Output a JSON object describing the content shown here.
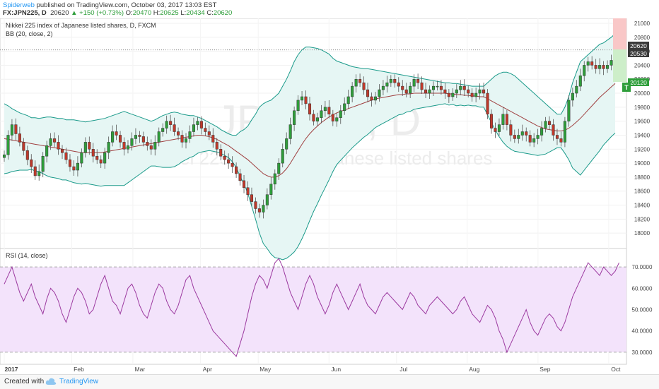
{
  "header": {
    "author": "Spiderweb",
    "published": " published on TradingView.com, October 03, 2017 13:03 EST",
    "symbol": "FX:JPN225, D",
    "last": "20620",
    "change": "▲ +150 (+0.73%)",
    "o_label": "O:",
    "o_val": "20470",
    "h_label": "H:",
    "h_val": "20625",
    "l_label": "L:",
    "l_val": "20434",
    "c_label": "C:",
    "c_val": "20620"
  },
  "legend": {
    "main_title": "Nikkei 225 index of Japanese listed shares, D, FXCM",
    "bb": "BB (20, close, 2)",
    "rsi": "RSI (14, close)"
  },
  "watermark": {
    "symbol": "JPN225, D",
    "desc": "Nikkei 225 index of Japanese listed shares"
  },
  "price_labels": {
    "last": "20620",
    "upper_marker": "20530",
    "lower_marker": "20120",
    "flag": "T"
  },
  "footer": {
    "created": "Created with",
    "brand": "TradingView"
  },
  "colors": {
    "up": "#2e9e3a",
    "down": "#c0392b",
    "bb_band": "#1a9a8a",
    "bb_mid": "#a04040",
    "bb_fill": "#e6f6f4",
    "rsi_line": "#9c3aa0",
    "rsi_fill": "#f3e3fb"
  },
  "chart_data": [
    {
      "type": "candlestick",
      "title": "Nikkei 225 index of Japanese listed shares, D, FXCM",
      "ylim": [
        17800,
        21050
      ],
      "y_ticks": [
        "21000",
        "20800",
        "20600",
        "20400",
        "20200",
        "20000",
        "19800",
        "19600",
        "19400",
        "19200",
        "19000",
        "18800",
        "18600",
        "18400",
        "18200",
        "18000"
      ],
      "x_ticks": [
        "2017",
        "Feb",
        "Mar",
        "Apr",
        "May",
        "Jun",
        "Jul",
        "Aug",
        "Sep",
        "Oct"
      ],
      "close": [
        19120,
        19400,
        19550,
        19420,
        19300,
        19180,
        19050,
        18950,
        18820,
        18880,
        19100,
        19250,
        19350,
        19300,
        19200,
        19150,
        19050,
        18950,
        18900,
        19000,
        19150,
        19300,
        19200,
        19100,
        19050,
        19000,
        19150,
        19300,
        19450,
        19400,
        19300,
        19200,
        19250,
        19350,
        19400,
        19380,
        19300,
        19250,
        19200,
        19300,
        19450,
        19500,
        19600,
        19550,
        19450,
        19400,
        19300,
        19350,
        19450,
        19550,
        19600,
        19500,
        19450,
        19400,
        19300,
        19200,
        19100,
        19050,
        19000,
        18950,
        18850,
        18750,
        18650,
        18550,
        18450,
        18350,
        18300,
        18400,
        18550,
        18700,
        18850,
        19000,
        19200,
        19350,
        19550,
        19750,
        19900,
        19950,
        19850,
        19700,
        19600,
        19650,
        19750,
        19800,
        19700,
        19600,
        19650,
        19750,
        19850,
        19950,
        20100,
        20200,
        20150,
        20050,
        19950,
        19900,
        19950,
        20050,
        20100,
        20150,
        20200,
        20150,
        20100,
        20050,
        20000,
        20100,
        20200,
        20150,
        20050,
        20000,
        20050,
        20100,
        20100,
        20050,
        20000,
        19950,
        20000,
        20050,
        20100,
        20050,
        20000,
        19950,
        20000,
        20050,
        20000,
        19700,
        19500,
        19450,
        19550,
        19700,
        19550,
        19400,
        19350,
        19400,
        19450,
        19400,
        19300,
        19350,
        19400,
        19500,
        19600,
        19550,
        19400,
        19350,
        19300,
        19600,
        19900,
        20000,
        20100,
        20250,
        20400,
        20450,
        20400,
        20350,
        20400,
        20350,
        20400,
        20470,
        20620
      ],
      "bb_upper": [
        19850,
        19820,
        19780,
        19750,
        19720,
        19700,
        19680,
        19650,
        19650,
        19640,
        19650,
        19660,
        19660,
        19650,
        19640,
        19640,
        19620,
        19620,
        19620,
        19610,
        19600,
        19590,
        19600,
        19610,
        19620,
        19630,
        19640,
        19660,
        19680,
        19700,
        19720,
        19740,
        19720,
        19700,
        19680,
        19660,
        19640,
        19620,
        19600,
        19620,
        19650,
        19680,
        19700,
        19720,
        19730,
        19720,
        19700,
        19690,
        19680,
        19680,
        19660,
        19640,
        19610,
        19580,
        19550,
        19520,
        19480,
        19450,
        19420,
        19400,
        19400,
        19450,
        19480,
        19530,
        19620,
        19700,
        19800,
        19850,
        19880,
        19900,
        19950,
        20000,
        20100,
        20200,
        20320,
        20450,
        20550,
        20620,
        20660,
        20660,
        20650,
        20640,
        20620,
        20590,
        20560,
        20500,
        20460,
        20440,
        20420,
        20400,
        20380,
        20370,
        20360,
        20350,
        20350,
        20340,
        20330,
        20320,
        20310,
        20300,
        20290,
        20280,
        20270,
        20260,
        20250,
        20240,
        20230,
        20220,
        20210,
        20200,
        20190,
        20180,
        20170,
        20160,
        20150,
        20150,
        20140,
        20140,
        20130,
        20120,
        20110,
        20100,
        20100,
        20100,
        20100,
        20150,
        20200,
        20250,
        20280,
        20300,
        20300,
        20280,
        20250,
        20200,
        20150,
        20100,
        20050,
        20000,
        19950,
        19900,
        19850,
        19800,
        19750,
        19700,
        19700,
        19800,
        19950,
        20150,
        20300,
        20450,
        20500,
        20550,
        20600,
        20650,
        20700,
        20720,
        20760,
        20800,
        20850
      ],
      "bb_mid": [
        19350,
        19340,
        19330,
        19320,
        19310,
        19300,
        19290,
        19280,
        19270,
        19260,
        19250,
        19240,
        19230,
        19220,
        19210,
        19200,
        19190,
        19180,
        19170,
        19160,
        19150,
        19150,
        19150,
        19150,
        19150,
        19150,
        19160,
        19170,
        19180,
        19190,
        19200,
        19210,
        19220,
        19230,
        19240,
        19250,
        19260,
        19270,
        19280,
        19290,
        19300,
        19310,
        19320,
        19330,
        19340,
        19350,
        19360,
        19370,
        19380,
        19390,
        19400,
        19400,
        19390,
        19380,
        19360,
        19340,
        19310,
        19280,
        19250,
        19210,
        19170,
        19130,
        19090,
        19050,
        19000,
        18950,
        18900,
        18850,
        18820,
        18800,
        18800,
        18820,
        18860,
        18920,
        19000,
        19090,
        19180,
        19270,
        19350,
        19420,
        19480,
        19530,
        19580,
        19620,
        19660,
        19690,
        19720,
        19740,
        19760,
        19780,
        19800,
        19820,
        19840,
        19860,
        19880,
        19900,
        19920,
        19930,
        19940,
        19950,
        19960,
        19970,
        19980,
        19980,
        19990,
        19990,
        20000,
        20000,
        20000,
        20000,
        20000,
        20000,
        20000,
        20000,
        20000,
        19990,
        19990,
        19980,
        19980,
        19970,
        19970,
        19960,
        19960,
        19950,
        19950,
        19920,
        19890,
        19860,
        19830,
        19800,
        19770,
        19740,
        19710,
        19680,
        19650,
        19620,
        19590,
        19560,
        19530,
        19510,
        19490,
        19480,
        19470,
        19460,
        19460,
        19470,
        19500,
        19540,
        19590,
        19640,
        19700,
        19760,
        19820,
        19880,
        19940,
        19990,
        20040,
        20090,
        20140
      ],
      "bb_lower": [
        18850,
        18860,
        18880,
        18890,
        18900,
        18900,
        18900,
        18910,
        18890,
        18880,
        18850,
        18820,
        18800,
        18790,
        18780,
        18760,
        18760,
        18740,
        18720,
        18710,
        18700,
        18710,
        18700,
        18690,
        18680,
        18670,
        18680,
        18680,
        18680,
        18680,
        18680,
        18680,
        18720,
        18760,
        18800,
        18840,
        18880,
        18920,
        18960,
        18960,
        18950,
        18940,
        18940,
        18940,
        18950,
        18980,
        19020,
        19050,
        19080,
        19100,
        19140,
        19160,
        19170,
        19180,
        19170,
        19160,
        19140,
        19110,
        19080,
        19020,
        18940,
        18810,
        18700,
        18570,
        18380,
        18200,
        18000,
        17850,
        17780,
        17700,
        17650,
        17640,
        17620,
        17640,
        17680,
        17730,
        17810,
        17920,
        18040,
        18180,
        18310,
        18420,
        18540,
        18650,
        18760,
        18880,
        18980,
        19040,
        19100,
        19160,
        19220,
        19270,
        19320,
        19370,
        19410,
        19460,
        19510,
        19540,
        19570,
        19600,
        19630,
        19660,
        19690,
        19700,
        19730,
        19740,
        19770,
        19780,
        19790,
        19800,
        19810,
        19820,
        19830,
        19840,
        19850,
        19830,
        19840,
        19820,
        19830,
        19820,
        19830,
        19820,
        19820,
        19800,
        19800,
        19690,
        19580,
        19470,
        19380,
        19300,
        19240,
        19200,
        19170,
        19160,
        19150,
        19140,
        19130,
        19120,
        19110,
        19120,
        19130,
        19160,
        19190,
        19220,
        19220,
        19140,
        19050,
        18930,
        18880,
        18830,
        18900,
        18970,
        19040,
        19110,
        19180,
        19260,
        19320,
        19380,
        19430
      ]
    },
    {
      "type": "line",
      "title": "RSI (14, close)",
      "ylim": [
        25,
        78
      ],
      "y_ticks": [
        "70.0000",
        "60.0000",
        "50.0000",
        "40.0000",
        "30.0000"
      ],
      "band": [
        30,
        70
      ],
      "values": [
        62,
        66,
        70,
        64,
        58,
        54,
        58,
        62,
        56,
        52,
        48,
        55,
        60,
        58,
        54,
        48,
        44,
        50,
        56,
        60,
        58,
        54,
        48,
        50,
        56,
        62,
        66,
        60,
        54,
        52,
        48,
        54,
        60,
        62,
        58,
        52,
        48,
        46,
        52,
        58,
        62,
        60,
        54,
        50,
        48,
        52,
        58,
        64,
        66,
        60,
        56,
        52,
        48,
        44,
        40,
        38,
        36,
        34,
        32,
        30,
        28,
        34,
        40,
        48,
        56,
        62,
        66,
        64,
        60,
        66,
        72,
        74,
        70,
        64,
        58,
        54,
        50,
        56,
        62,
        66,
        62,
        56,
        52,
        48,
        52,
        58,
        62,
        58,
        54,
        50,
        54,
        58,
        62,
        56,
        52,
        50,
        48,
        52,
        56,
        58,
        56,
        54,
        52,
        50,
        54,
        58,
        56,
        52,
        50,
        48,
        52,
        54,
        56,
        54,
        52,
        50,
        48,
        50,
        54,
        56,
        52,
        48,
        46,
        44,
        48,
        52,
        50,
        46,
        40,
        36,
        30,
        34,
        38,
        42,
        46,
        50,
        44,
        40,
        38,
        42,
        46,
        48,
        46,
        42,
        40,
        44,
        50,
        56,
        60,
        64,
        68,
        72,
        70,
        68,
        66,
        70,
        68,
        66,
        68,
        72
      ]
    }
  ]
}
